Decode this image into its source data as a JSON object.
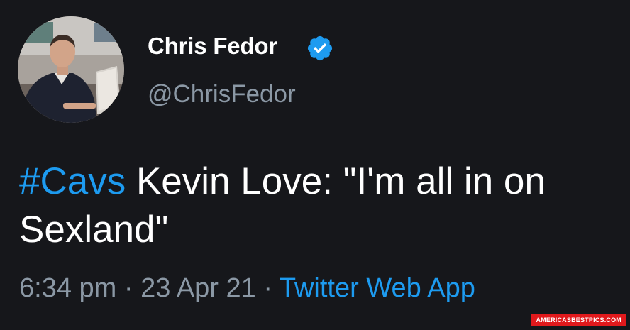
{
  "author": {
    "display_name": "Chris Fedor",
    "handle": "@ChrisFedor",
    "verified": true,
    "avatar_icon": "person-at-laptop-photo"
  },
  "tweet": {
    "hashtag": "#Cavs",
    "text": " Kevin Love: \"I'm all in on Sexland\"",
    "time": "6:34 pm",
    "separator": " · ",
    "date": "23 Apr 21",
    "source": "Twitter Web App"
  },
  "watermark": {
    "text": "AMERICASBESTPICS.COM"
  },
  "colors": {
    "background": "#16171b",
    "accent": "#1d9bf0",
    "muted": "#8b98a5",
    "text": "#ffffff",
    "watermark_bg": "#e1191c"
  }
}
